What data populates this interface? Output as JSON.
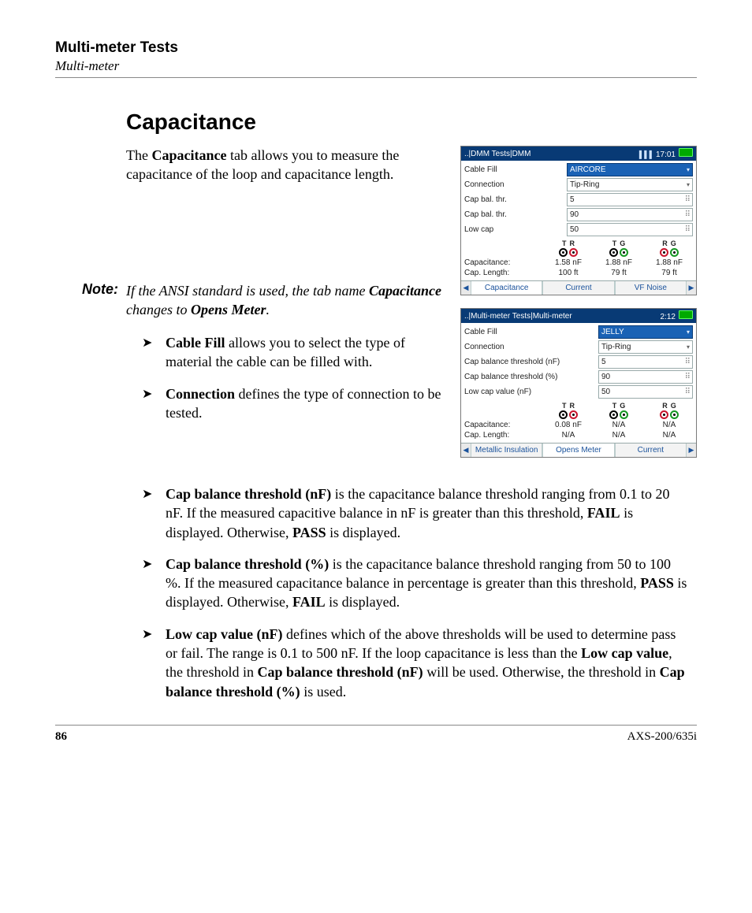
{
  "header": {
    "chapter": "Multi-meter Tests",
    "section": "Multi-meter"
  },
  "heading": "Capacitance",
  "intro": {
    "pre": "The ",
    "b1": "Capacitance",
    "post": " tab allows you to measure the capacitance of the loop and capacitance length."
  },
  "note": {
    "label": "Note:",
    "p1": "If the ANSI standard is used, the tab name ",
    "b1": "Capacitance",
    "p2": " changes to ",
    "b2": "Opens Meter",
    "p3": "."
  },
  "bullets_short": [
    {
      "b": "Cable Fill",
      "t": " allows you to select the type of material the cable can be filled with."
    },
    {
      "b": "Connection",
      "t": " defines the type of connection to be tested."
    }
  ],
  "bullets_full": [
    {
      "parts": [
        {
          "b": "Cap balance threshold (nF)"
        },
        {
          "t": " is the capacitance balance threshold ranging from 0.1 to 20 nF. If the measured capacitive balance in nF is greater than this threshold, "
        },
        {
          "b": "FAIL"
        },
        {
          "t": " is displayed. Otherwise, "
        },
        {
          "b": "PASS"
        },
        {
          "t": " is displayed."
        }
      ]
    },
    {
      "parts": [
        {
          "b": "Cap balance threshold (%)"
        },
        {
          "t": " is the capacitance balance threshold ranging from 50 to 100 %. If the measured capacitance balance in percentage is greater than this threshold, "
        },
        {
          "b": "PASS"
        },
        {
          "t": " is displayed. Otherwise, "
        },
        {
          "b": "FAIL"
        },
        {
          "t": " is displayed."
        }
      ]
    },
    {
      "parts": [
        {
          "b": "Low cap value (nF)"
        },
        {
          "t": " defines which of the above thresholds will be used to determine pass or fail. The range is 0.1 to 500 nF. If the loop capacitance is less than the "
        },
        {
          "b": "Low cap value"
        },
        {
          "t": ", the threshold in "
        },
        {
          "b": "Cap balance threshold (nF)"
        },
        {
          "t": " will be used. Otherwise, the threshold in "
        },
        {
          "b": "Cap balance threshold (%)"
        },
        {
          "t": " is used."
        }
      ]
    }
  ],
  "device1": {
    "breadcrumb": "..|DMM Tests|DMM",
    "time": "17:01",
    "rows": [
      {
        "label": "Cable Fill",
        "value": "AIRCORE",
        "type": "sel"
      },
      {
        "label": "Connection",
        "value": "Tip-Ring",
        "type": "dd"
      },
      {
        "label": "Cap bal. thr.",
        "value": "5",
        "type": "num"
      },
      {
        "label": "Cap bal. thr.",
        "value": "90",
        "type": "num"
      },
      {
        "label": "Low cap",
        "value": "50",
        "type": "num"
      }
    ],
    "pairs": [
      {
        "l1": "T",
        "l2": "R",
        "c1": "black",
        "c2": "red"
      },
      {
        "l1": "T",
        "l2": "G",
        "c1": "black",
        "c2": "green"
      },
      {
        "l1": "R",
        "l2": "G",
        "c1": "red",
        "c2": "green"
      }
    ],
    "data": [
      {
        "label": "Capacitance:",
        "v": [
          "1.58 nF",
          "1.88 nF",
          "1.88 nF"
        ]
      },
      {
        "label": "Cap. Length:",
        "v": [
          "100 ft",
          "79 ft",
          "79 ft"
        ]
      }
    ],
    "tabs": [
      "Capacitance",
      "Current",
      "VF Noise"
    ],
    "active_tab": 0
  },
  "device2": {
    "breadcrumb": "..|Multi-meter Tests|Multi-meter",
    "time": "2:12",
    "rows": [
      {
        "label": "Cable Fill",
        "value": "JELLY",
        "type": "sel"
      },
      {
        "label": "Connection",
        "value": "Tip-Ring",
        "type": "dd"
      },
      {
        "label": "Cap balance threshold (nF)",
        "value": "5",
        "type": "num"
      },
      {
        "label": "Cap balance threshold (%)",
        "value": "90",
        "type": "num"
      },
      {
        "label": "Low cap value (nF)",
        "value": "50",
        "type": "num"
      }
    ],
    "pairs": [
      {
        "l1": "T",
        "l2": "R",
        "c1": "black",
        "c2": "red"
      },
      {
        "l1": "T",
        "l2": "G",
        "c1": "black",
        "c2": "green"
      },
      {
        "l1": "R",
        "l2": "G",
        "c1": "red",
        "c2": "green"
      }
    ],
    "data": [
      {
        "label": "Capacitance:",
        "v": [
          "0.08 nF",
          "N/A",
          "N/A"
        ]
      },
      {
        "label": "Cap. Length:",
        "v": [
          "N/A",
          "N/A",
          "N/A"
        ]
      }
    ],
    "tabs": [
      "Metallic Insulation",
      "Opens Meter",
      "Current"
    ],
    "active_tab": 1
  },
  "footer": {
    "page": "86",
    "model": "AXS-200/635i"
  }
}
